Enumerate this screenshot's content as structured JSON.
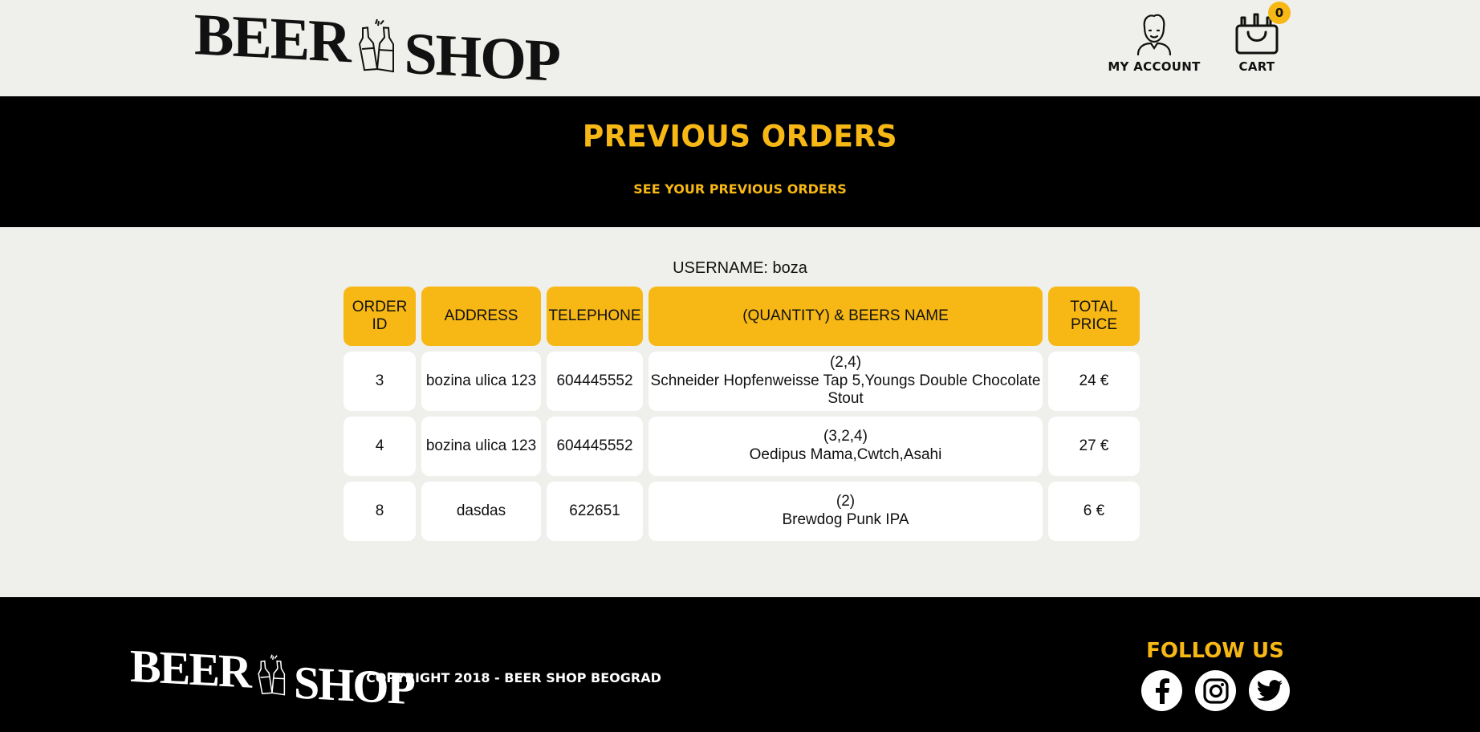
{
  "header": {
    "logo": {
      "word1": "BEER",
      "word2": "SHOP"
    },
    "account_label": "MY ACCOUNT",
    "cart_label": "CART",
    "cart_count": "0"
  },
  "banner": {
    "title": "PREVIOUS ORDERS",
    "subtitle": "SEE YOUR PREVIOUS ORDERS"
  },
  "user": {
    "label": "USERNAME: boza"
  },
  "table": {
    "headers": {
      "order_id": "ORDER ID",
      "address": "ADDRESS",
      "telephone": "TELEPHONE",
      "beers": "(QUANTITY) & BEERS NAME",
      "total": "TOTAL PRICE"
    },
    "rows": [
      {
        "id": "3",
        "address": "bozina ulica 123",
        "telephone": "604445552",
        "quantity": "(2,4)",
        "beers": "Schneider Hopfenweisse Tap 5,Youngs Double Chocolate Stout",
        "total": "24 €"
      },
      {
        "id": "4",
        "address": "bozina ulica 123",
        "telephone": "604445552",
        "quantity": "(3,2,4)",
        "beers": "Oedipus Mama,Cwtch,Asahi",
        "total": "27 €"
      },
      {
        "id": "8",
        "address": "dasdas",
        "telephone": "622651",
        "quantity": "(2)",
        "beers": "Brewdog Punk IPA",
        "total": "6 €"
      }
    ]
  },
  "footer": {
    "logo": {
      "word1": "BEER",
      "word2": "SHOP"
    },
    "copyright": "COPYRIGHT 2018 - BEER SHOP BEOGRAD",
    "follow_label": "FOLLOW US",
    "socials": [
      "facebook-icon",
      "instagram-icon",
      "twitter-icon"
    ]
  },
  "colors": {
    "accent": "#f7b815",
    "background": "#efefeb",
    "dark": "#000000"
  }
}
